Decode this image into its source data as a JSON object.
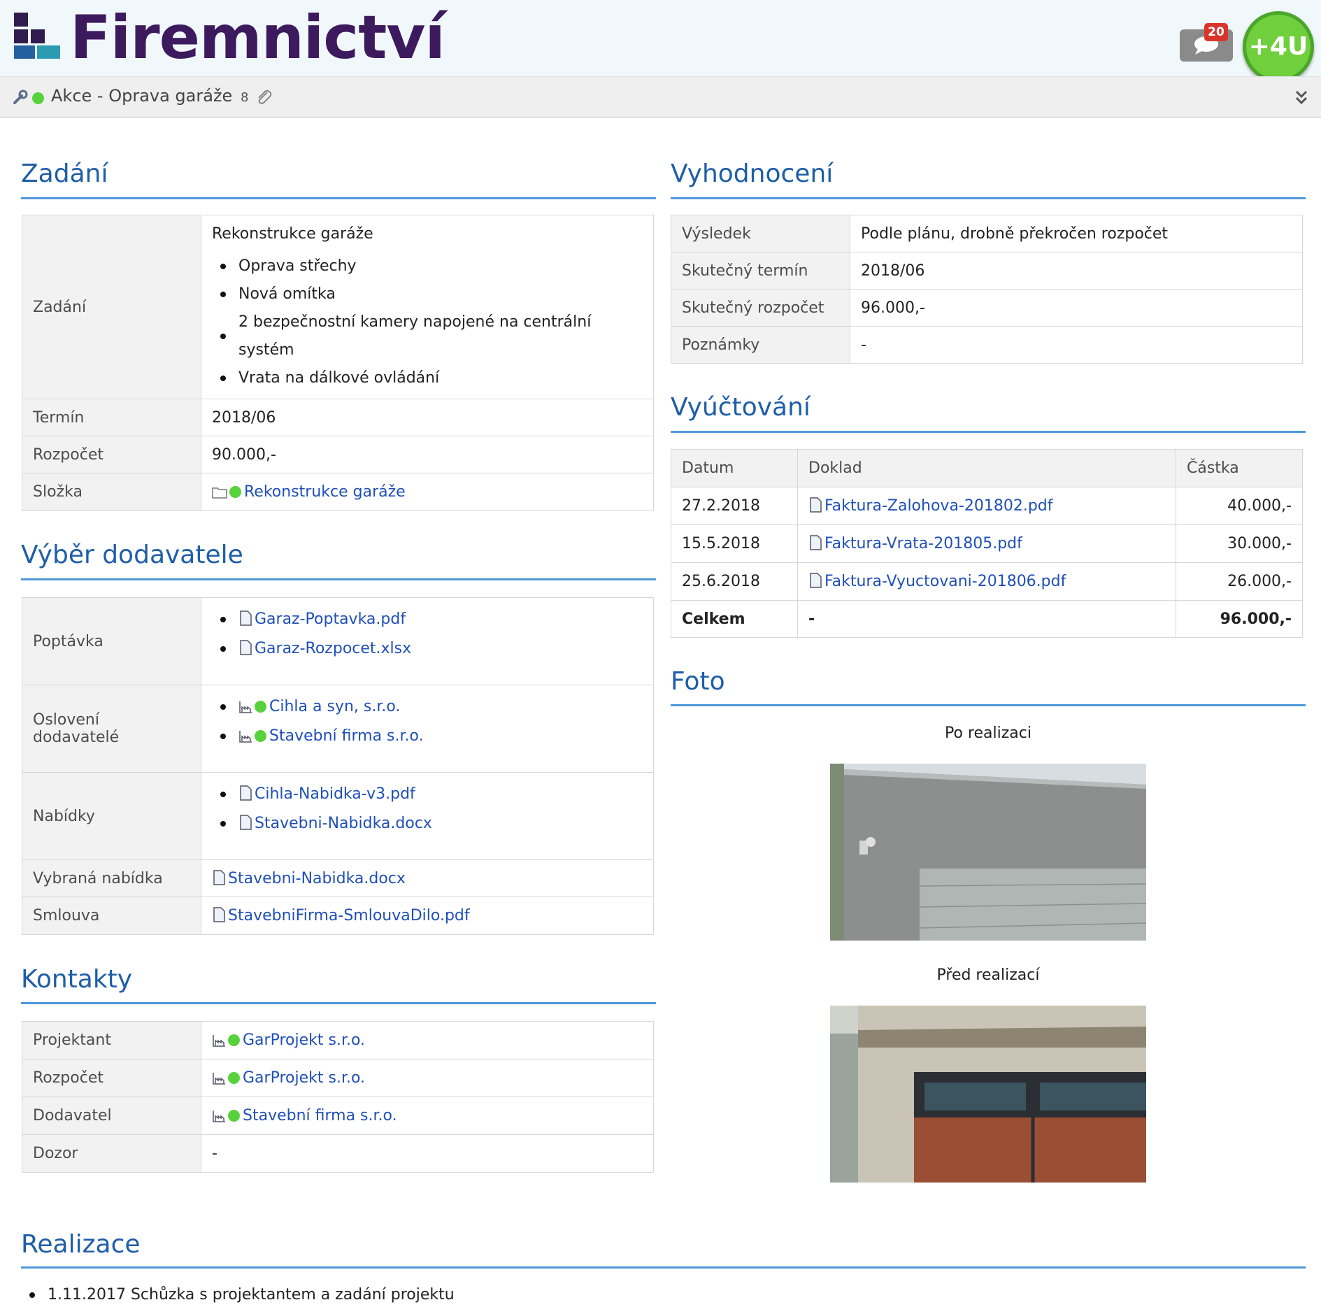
{
  "header": {
    "brand": "Firemnictví",
    "notification_count": "20",
    "plus4u_label": "+4U",
    "colors": {
      "brand": "#3d1a5e",
      "logo_dark": "#2f1b4e",
      "logo_teal": "#2a9bb0",
      "logo_blue": "#2460a0",
      "accent": "#6fcf3c"
    }
  },
  "subbar": {
    "title": "Akce - Oprava garáže",
    "attachments": "8",
    "status_color": "#58d23c"
  },
  "zadani": {
    "heading": "Zadání",
    "rows": {
      "zadani_label": "Zadání",
      "zadani_intro": "Rekonstrukce garáže",
      "zadani_items": [
        "Oprava střechy",
        "Nová omítka",
        "2 bezpečnostní kamery napojené na centrální systém",
        "Vrata na dálkové ovládání"
      ],
      "termin_label": "Termín",
      "termin_value": "2018/06",
      "rozpocet_label": "Rozpočet",
      "rozpocet_value": "90.000,-",
      "slozka_label": "Složka",
      "slozka_value": "Rekonstrukce garáže"
    }
  },
  "vyber": {
    "heading": "Výběr dodavatele",
    "poptavka_label": "Poptávka",
    "poptavka_files": [
      "Garaz-Poptavka.pdf",
      "Garaz-Rozpocet.xlsx"
    ],
    "osloveni_label": "Oslovení dodavatelé",
    "osloveni_items": [
      "Cihla a syn, s.r.o.",
      "Stavební firma s.r.o."
    ],
    "nabidky_label": "Nabídky",
    "nabidky_files": [
      "Cihla-Nabidka-v3.pdf",
      "Stavebni-Nabidka.docx"
    ],
    "vybrana_label": "Vybraná nabídka",
    "vybrana_value": "Stavebni-Nabidka.docx",
    "smlouva_label": "Smlouva",
    "smlouva_value": "StavebniFirma-SmlouvaDilo.pdf"
  },
  "kontakty": {
    "heading": "Kontakty",
    "rows": [
      {
        "label": "Projektant",
        "value": "GarProjekt s.r.o."
      },
      {
        "label": "Rozpočet",
        "value": "GarProjekt s.r.o."
      },
      {
        "label": "Dodavatel",
        "value": "Stavební firma s.r.o."
      },
      {
        "label": "Dozor",
        "value": "-"
      }
    ]
  },
  "vyhodnoceni": {
    "heading": "Vyhodnocení",
    "rows": [
      {
        "label": "Výsledek",
        "value": "Podle plánu, drobně překročen rozpočet"
      },
      {
        "label": "Skutečný termín",
        "value": "2018/06"
      },
      {
        "label": "Skutečný rozpočet",
        "value": "96.000,-"
      },
      {
        "label": "Poznámky",
        "value": "-"
      }
    ]
  },
  "vyuctovani": {
    "heading": "Vyúčtování",
    "columns": [
      "Datum",
      "Doklad",
      "Částka"
    ],
    "rows": [
      {
        "date": "27.2.2018",
        "doc": "Faktura-Zalohova-201802.pdf",
        "amount": "40.000,-"
      },
      {
        "date": "15.5.2018",
        "doc": "Faktura-Vrata-201805.pdf",
        "amount": "30.000,-"
      },
      {
        "date": "25.6.2018",
        "doc": "Faktura-Vyuctovani-201806.pdf",
        "amount": "26.000,-"
      }
    ],
    "total": {
      "label": "Celkem",
      "doc": "-",
      "amount": "96.000,-"
    }
  },
  "foto": {
    "heading": "Foto",
    "after_caption": "Po realizaci",
    "before_caption": "Před realizací"
  },
  "realizace": {
    "heading": "Realizace",
    "items": [
      "1.11.2017 Schůzka s projektantem a zadání projektu"
    ]
  }
}
